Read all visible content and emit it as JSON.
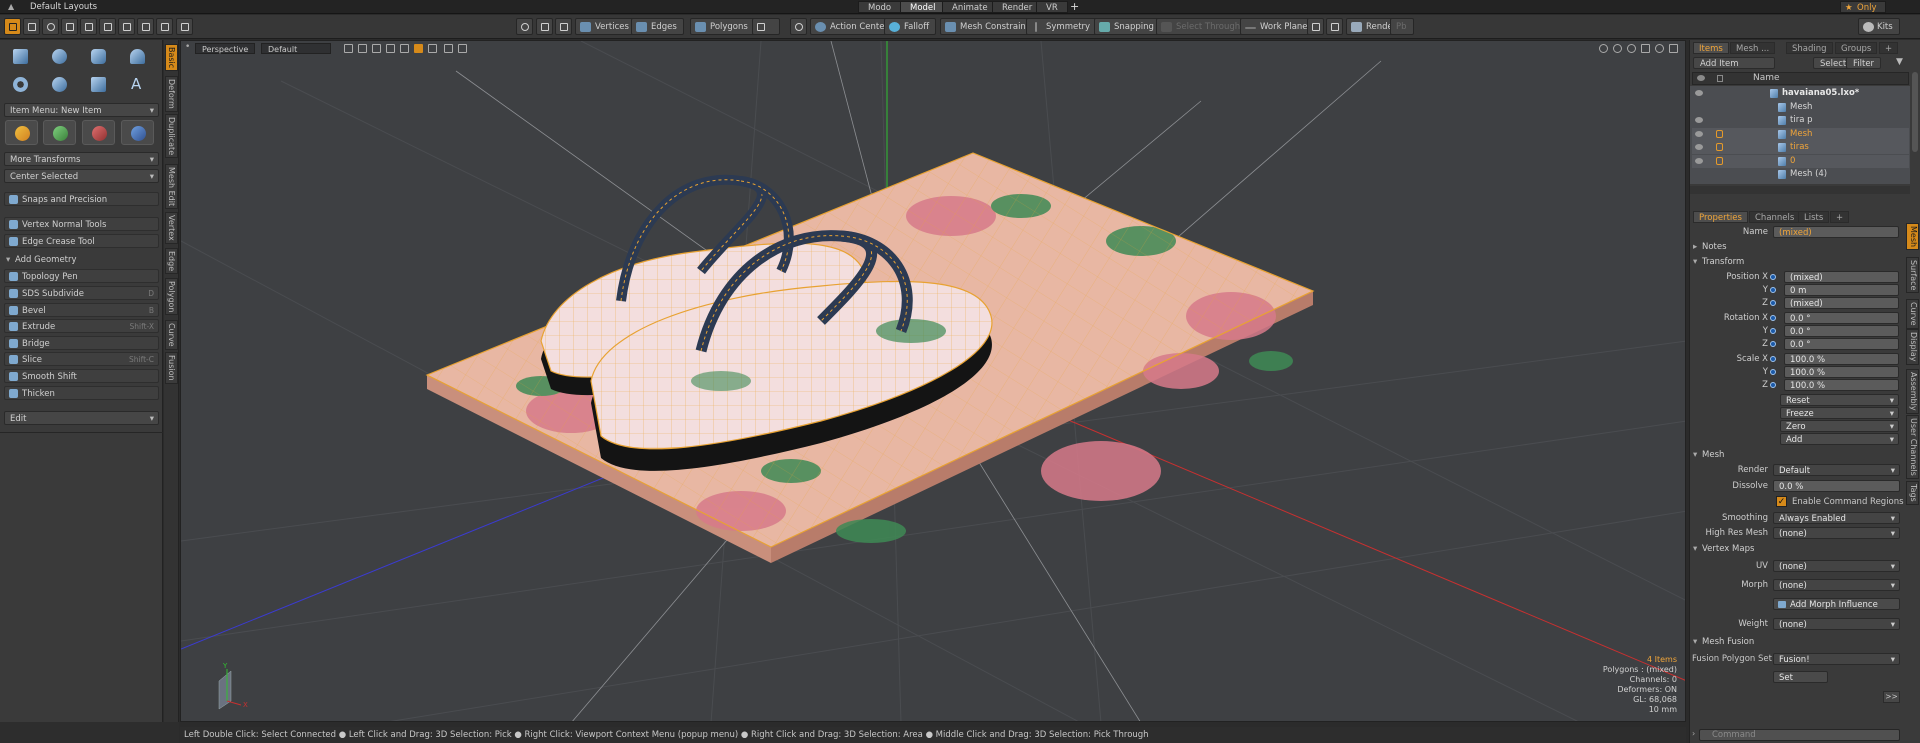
{
  "app": {
    "layout_title": "Default Layouts",
    "only_label": "Only",
    "kits_label": "Kits"
  },
  "menu_tabs": [
    "Modo",
    "Model",
    "Animate",
    "Render",
    "VR",
    "+"
  ],
  "toolbar": {
    "vertices": "Vertices",
    "edges": "Edges",
    "polygons": "Polygons",
    "action_center": "Action Center",
    "falloff": "Falloff",
    "mesh_constraint": "Mesh Constraint",
    "symmetry": "Symmetry",
    "snapping": "Snapping",
    "select_through": "Select Through",
    "work_plane": "Work Plane",
    "render": "Render",
    "pb": "Pb"
  },
  "left_panel": {
    "item_menu": "Item Menu: New Item",
    "more_transforms": "More Transforms",
    "center_selected": "Center Selected",
    "snaps": "Snaps and Precision",
    "vertex_normal": "Vertex Normal Tools",
    "edge_crease": "Edge Crease Tool",
    "add_geometry": "Add Geometry",
    "tools": [
      {
        "label": "Topology Pen",
        "shortcut": ""
      },
      {
        "label": "SDS Subdivide",
        "shortcut": "D"
      },
      {
        "label": "Bevel",
        "shortcut": "B"
      },
      {
        "label": "Extrude",
        "shortcut": "Shift-X"
      },
      {
        "label": "Bridge",
        "shortcut": ""
      },
      {
        "label": "Slice",
        "shortcut": "Shift-C"
      },
      {
        "label": "Smooth Shift",
        "shortcut": ""
      },
      {
        "label": "Thicken",
        "shortcut": ""
      }
    ],
    "edit": "Edit"
  },
  "left_vtabs": [
    "Basic",
    "Deform",
    "Duplicate",
    "Mesh Edit",
    "Vertex",
    "Edge",
    "Polygon",
    "Curve",
    "Fusion"
  ],
  "viewport": {
    "perspective": "Perspective",
    "default": "Default"
  },
  "stats": {
    "items": "4 Items",
    "polygons": "Polygons : (mixed)",
    "channels": "Channels: 0",
    "deformers": "Deformers: ON",
    "gl": "GL: 68,068",
    "scale": "10 mm"
  },
  "status_bar": "Left Double Click: Select Connected ● Left Click and Drag: 3D Selection: Pick ● Right Click: Viewport Context Menu (popup menu) ● Right Click and Drag: 3D Selection: Area ● Middle Click and Drag: 3D Selection: Pick Through",
  "items_panel": {
    "tabs": [
      "Items",
      "Mesh ...",
      "Shading",
      "Groups",
      "+"
    ],
    "add_item": "Add Item",
    "select": "Select",
    "filter": "Filter",
    "name_col": "Name",
    "rows": [
      {
        "label": "havaiana05.lxo*",
        "indent": 0,
        "color": "#e8e8e8",
        "eye": true,
        "lock": false,
        "bold": true
      },
      {
        "label": "Mesh",
        "indent": 1,
        "color": "#d8d8d8",
        "eye": false,
        "lock": false,
        "bold": false
      },
      {
        "label": "tira p",
        "indent": 1,
        "color": "#d8d8d8",
        "eye": true,
        "lock": false,
        "bold": false
      },
      {
        "label": "Mesh",
        "indent": 1,
        "color": "#f0a53a",
        "eye": true,
        "lock": true,
        "bold": false
      },
      {
        "label": "tiras",
        "indent": 1,
        "color": "#f0a53a",
        "eye": true,
        "lock": true,
        "bold": false
      },
      {
        "label": "0",
        "indent": 1,
        "color": "#f0a53a",
        "eye": true,
        "lock": true,
        "bold": false
      },
      {
        "label": "Mesh (4)",
        "indent": 1,
        "color": "#d8d8d8",
        "eye": false,
        "lock": false,
        "bold": false
      }
    ]
  },
  "properties": {
    "tabs": [
      "Properties",
      "Channels",
      "Lists",
      "+"
    ],
    "name_label": "Name",
    "name_value": "(mixed)",
    "notes": "Notes",
    "transform": "Transform",
    "position_x_label": "Position X",
    "position_x": "(mixed)",
    "position_y": "0 m",
    "position_z": "(mixed)",
    "rotation_x_label": "Rotation X",
    "rotation_x": "0.0 °",
    "rotation_y": "0.0 °",
    "rotation_z": "0.0 °",
    "scale_x_label": "Scale X",
    "scale_x": "100.0 %",
    "scale_y": "100.0 %",
    "scale_z": "100.0 %",
    "y": "Y",
    "z": "Z",
    "reset": "Reset",
    "freeze": "Freeze",
    "zero": "Zero",
    "add": "Add",
    "mesh_section": "Mesh",
    "render_label": "Render",
    "render": "Default",
    "dissolve_label": "Dissolve",
    "dissolve": "0.0 %",
    "enable_cmd": "Enable Command Regions",
    "smoothing_label": "Smoothing",
    "smoothing": "Always Enabled",
    "highres_label": "High Res Mesh",
    "highres": "(none)",
    "vmaps_section": "Vertex Maps",
    "uv_label": "UV",
    "uv": "(none)",
    "morph_label": "Morph",
    "morph": "(none)",
    "add_morph": "Add Morph Influence",
    "weight_label": "Weight",
    "weight": "(none)",
    "fusion_section": "Mesh Fusion",
    "fusion_label": "Fusion Polygon Set",
    "fusion": "Fusion!",
    "set": "Set",
    "more": ">>",
    "command_placeholder": "Command"
  },
  "right_vtabs": [
    "Mesh",
    "Surface",
    "Curve",
    "Display",
    "Assembly",
    "User Channels",
    "Tags"
  ],
  "colors": {
    "accent": "#f0a53a",
    "wire": "#e8a232",
    "board": "#e8b7a3",
    "leaf": "#3f8a55",
    "flower": "#d77a8a",
    "strap": "#2c3a52",
    "grid": "#4a4c50"
  }
}
